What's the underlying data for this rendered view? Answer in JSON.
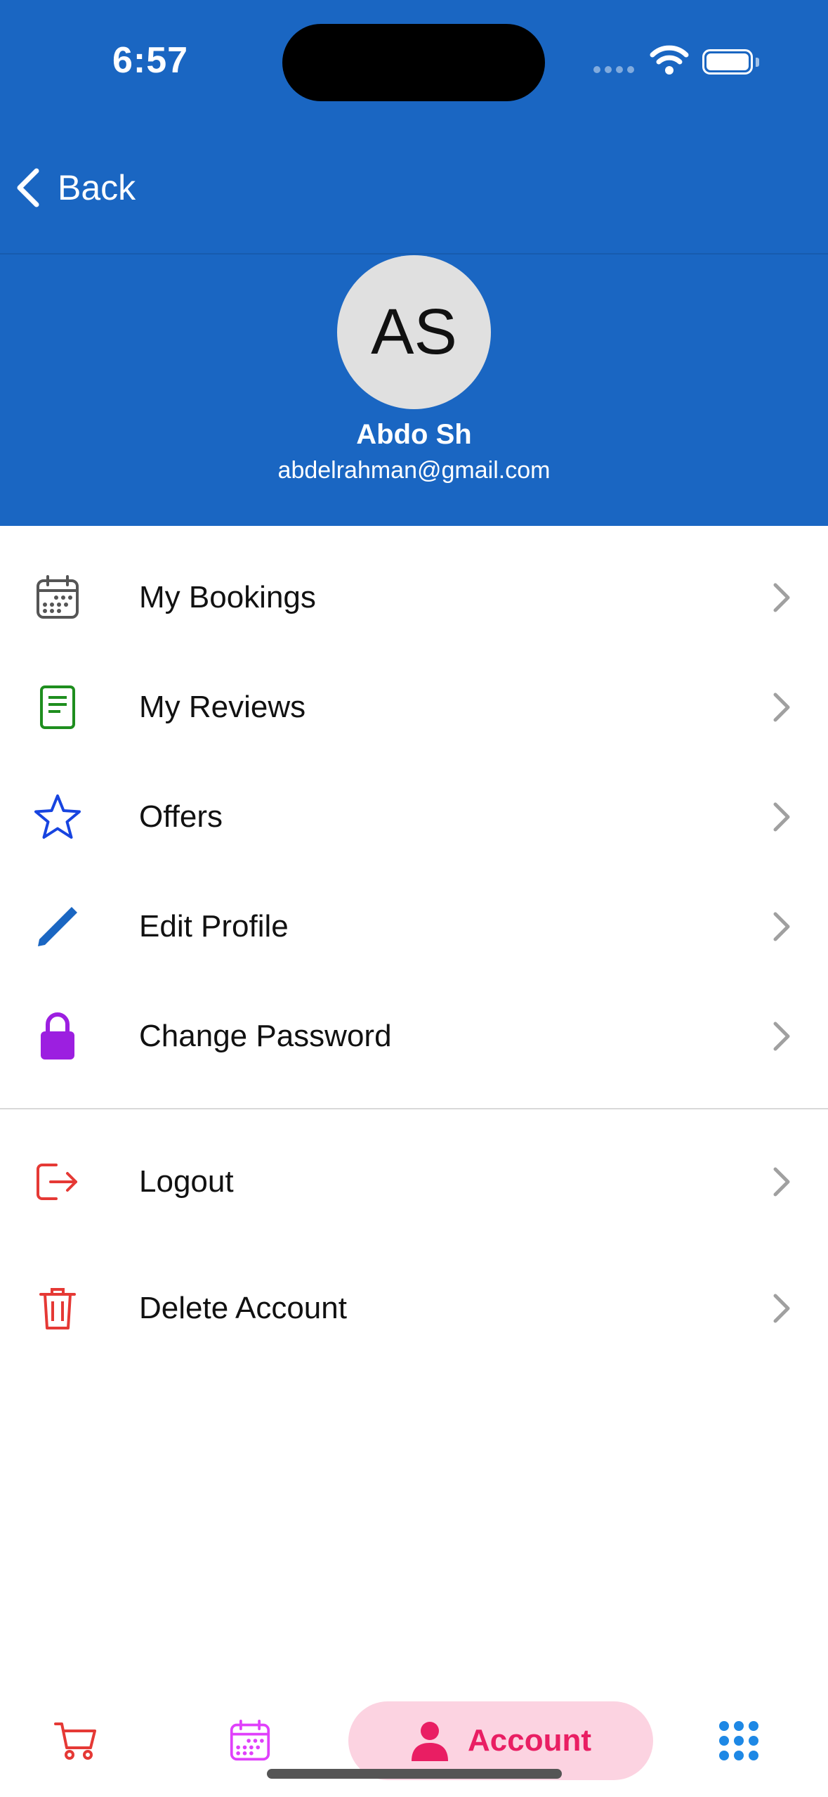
{
  "status_bar": {
    "time": "6:57"
  },
  "nav": {
    "back_label": "Back"
  },
  "profile": {
    "initials": "AS",
    "name": "Abdo Sh",
    "email": "abdelrahman@gmail.com"
  },
  "menu": {
    "items": [
      {
        "label": "My Bookings",
        "icon": "calendar-icon",
        "color": "#555555"
      },
      {
        "label": "My Reviews",
        "icon": "document-icon",
        "color": "#1E8E1E"
      },
      {
        "label": "Offers",
        "icon": "star-icon",
        "color": "#1744E0"
      },
      {
        "label": "Edit Profile",
        "icon": "pencil-icon",
        "color": "#1A66C2"
      },
      {
        "label": "Change Password",
        "icon": "lock-icon",
        "color": "#9C1FE0"
      }
    ],
    "danger_items": [
      {
        "label": "Logout",
        "icon": "logout-icon",
        "color": "#E53935"
      },
      {
        "label": "Delete Account",
        "icon": "trash-icon",
        "color": "#E53935"
      }
    ]
  },
  "tab_bar": {
    "tabs": [
      {
        "icon": "cart-icon",
        "color": "#E53935"
      },
      {
        "icon": "calendar-icon",
        "color": "#E040FB"
      },
      {
        "icon": "person-icon",
        "label": "Account",
        "color": "#E91E63",
        "active": true
      },
      {
        "icon": "grid-icon",
        "color": "#1E88E5"
      }
    ]
  },
  "colors": {
    "header": "#1A66C2",
    "active_tab_bg": "#FCD3E1"
  }
}
